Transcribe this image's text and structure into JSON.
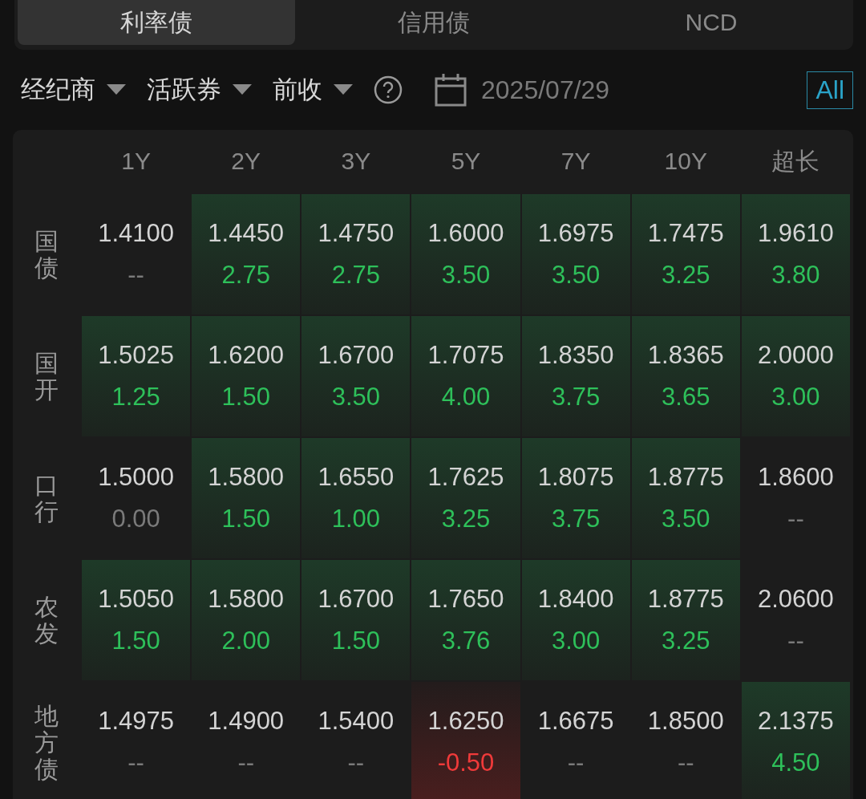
{
  "tabs": [
    {
      "label": "利率债",
      "selected": true
    },
    {
      "label": "信用债",
      "selected": false
    },
    {
      "label": "NCD",
      "selected": false
    }
  ],
  "filters": [
    {
      "label": "经纪商"
    },
    {
      "label": "活跃券"
    },
    {
      "label": "前收"
    }
  ],
  "date": "2025/07/29",
  "all_button": "All",
  "columns": [
    "1Y",
    "2Y",
    "3Y",
    "5Y",
    "7Y",
    "10Y",
    "超长"
  ],
  "rows": [
    {
      "label": "国债",
      "cells": [
        {
          "yield": "1.4100",
          "change": "--",
          "kind": "flat"
        },
        {
          "yield": "1.4450",
          "change": "2.75",
          "kind": "up"
        },
        {
          "yield": "1.4750",
          "change": "2.75",
          "kind": "up"
        },
        {
          "yield": "1.6000",
          "change": "3.50",
          "kind": "up"
        },
        {
          "yield": "1.6975",
          "change": "3.50",
          "kind": "up"
        },
        {
          "yield": "1.7475",
          "change": "3.25",
          "kind": "up"
        },
        {
          "yield": "1.9610",
          "change": "3.80",
          "kind": "up"
        }
      ]
    },
    {
      "label": "国开",
      "cells": [
        {
          "yield": "1.5025",
          "change": "1.25",
          "kind": "up"
        },
        {
          "yield": "1.6200",
          "change": "1.50",
          "kind": "up"
        },
        {
          "yield": "1.6700",
          "change": "3.50",
          "kind": "up"
        },
        {
          "yield": "1.7075",
          "change": "4.00",
          "kind": "up"
        },
        {
          "yield": "1.8350",
          "change": "3.75",
          "kind": "up"
        },
        {
          "yield": "1.8365",
          "change": "3.65",
          "kind": "up"
        },
        {
          "yield": "2.0000",
          "change": "3.00",
          "kind": "up"
        }
      ]
    },
    {
      "label": "口行",
      "cells": [
        {
          "yield": "1.5000",
          "change": "0.00",
          "kind": "flat"
        },
        {
          "yield": "1.5800",
          "change": "1.50",
          "kind": "up"
        },
        {
          "yield": "1.6550",
          "change": "1.00",
          "kind": "up"
        },
        {
          "yield": "1.7625",
          "change": "3.25",
          "kind": "up"
        },
        {
          "yield": "1.8075",
          "change": "3.75",
          "kind": "up"
        },
        {
          "yield": "1.8775",
          "change": "3.50",
          "kind": "up"
        },
        {
          "yield": "1.8600",
          "change": "--",
          "kind": "flat"
        }
      ]
    },
    {
      "label": "农发",
      "cells": [
        {
          "yield": "1.5050",
          "change": "1.50",
          "kind": "up"
        },
        {
          "yield": "1.5800",
          "change": "2.00",
          "kind": "up"
        },
        {
          "yield": "1.6700",
          "change": "1.50",
          "kind": "up"
        },
        {
          "yield": "1.7650",
          "change": "3.76",
          "kind": "up"
        },
        {
          "yield": "1.8400",
          "change": "3.00",
          "kind": "up"
        },
        {
          "yield": "1.8775",
          "change": "3.25",
          "kind": "up"
        },
        {
          "yield": "2.0600",
          "change": "--",
          "kind": "flat"
        }
      ]
    },
    {
      "label": "地方债",
      "cells": [
        {
          "yield": "1.4975",
          "change": "--",
          "kind": "flat"
        },
        {
          "yield": "1.4900",
          "change": "--",
          "kind": "flat"
        },
        {
          "yield": "1.5400",
          "change": "--",
          "kind": "flat"
        },
        {
          "yield": "1.6250",
          "change": "-0.50",
          "kind": "down"
        },
        {
          "yield": "1.6675",
          "change": "--",
          "kind": "flat"
        },
        {
          "yield": "1.8500",
          "change": "--",
          "kind": "flat"
        },
        {
          "yield": "2.1375",
          "change": "4.50",
          "kind": "up"
        }
      ]
    }
  ]
}
